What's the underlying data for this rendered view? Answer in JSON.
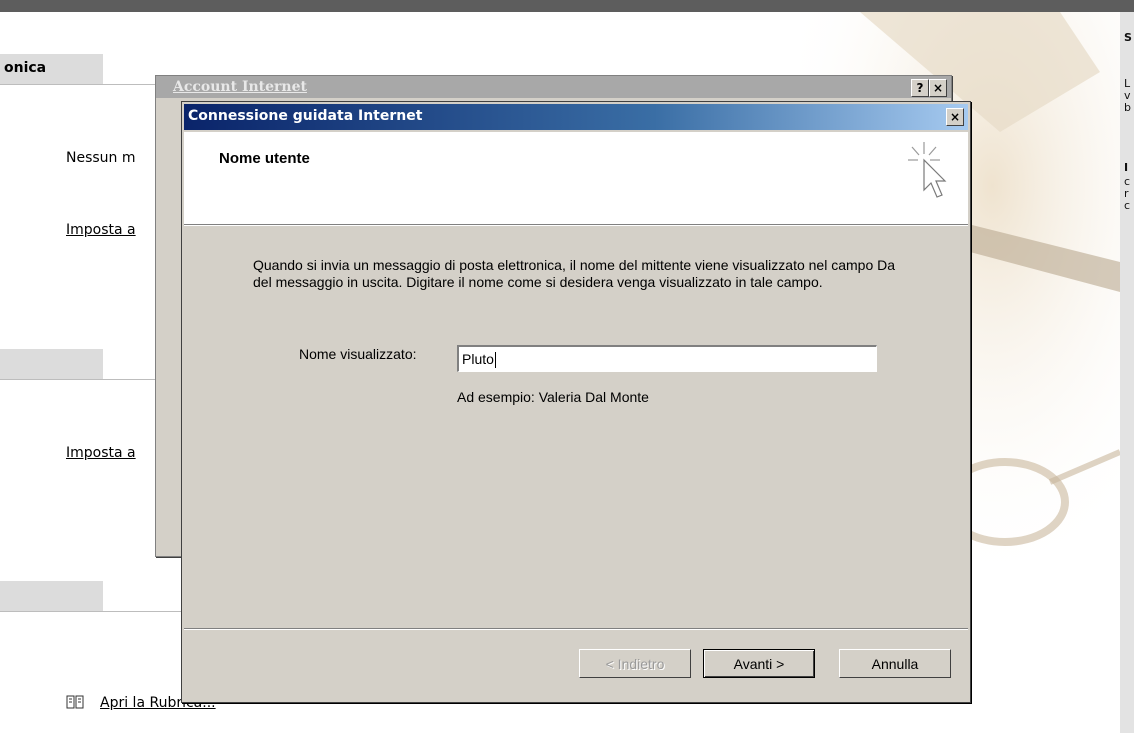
{
  "page": {
    "sections": [
      {
        "title": "onica"
      },
      {
        "title": ""
      },
      {
        "title": ""
      }
    ],
    "no_message_text": "Nessun m",
    "setup_link_1": "Imposta a",
    "setup_link_2": "Imposta a",
    "addressbook_link": "Apri la Rubrica...",
    "right_col_lines": [
      "S",
      "L",
      "v",
      "b",
      "I",
      "c",
      "r",
      "c"
    ]
  },
  "back_dialog": {
    "title": "Account Internet",
    "help_button": "?",
    "close_button": "×"
  },
  "wizard": {
    "title": "Connessione guidata Internet",
    "close_button": "×",
    "header_title": "Nome utente",
    "description": "Quando si invia un messaggio di posta elettronica, il nome del mittente viene visualizzato nel campo Da del messaggio in uscita. Digitare il nome come si desidera venga visualizzato in tale campo.",
    "field_label": "Nome visualizzato:",
    "field_value": "Pluto",
    "example_text": "Ad esempio: Valeria Dal Monte",
    "buttons": {
      "back": "< Indietro",
      "next": "Avanti >",
      "cancel": "Annulla"
    }
  },
  "colors": {
    "title_bar_start": "#0a246a",
    "title_bar_end": "#a6caf0",
    "dialog_face": "#d4d0c8"
  },
  "icons": [
    "wizard-cursor-icon",
    "address-book-icon",
    "help-icon",
    "close-icon"
  ]
}
